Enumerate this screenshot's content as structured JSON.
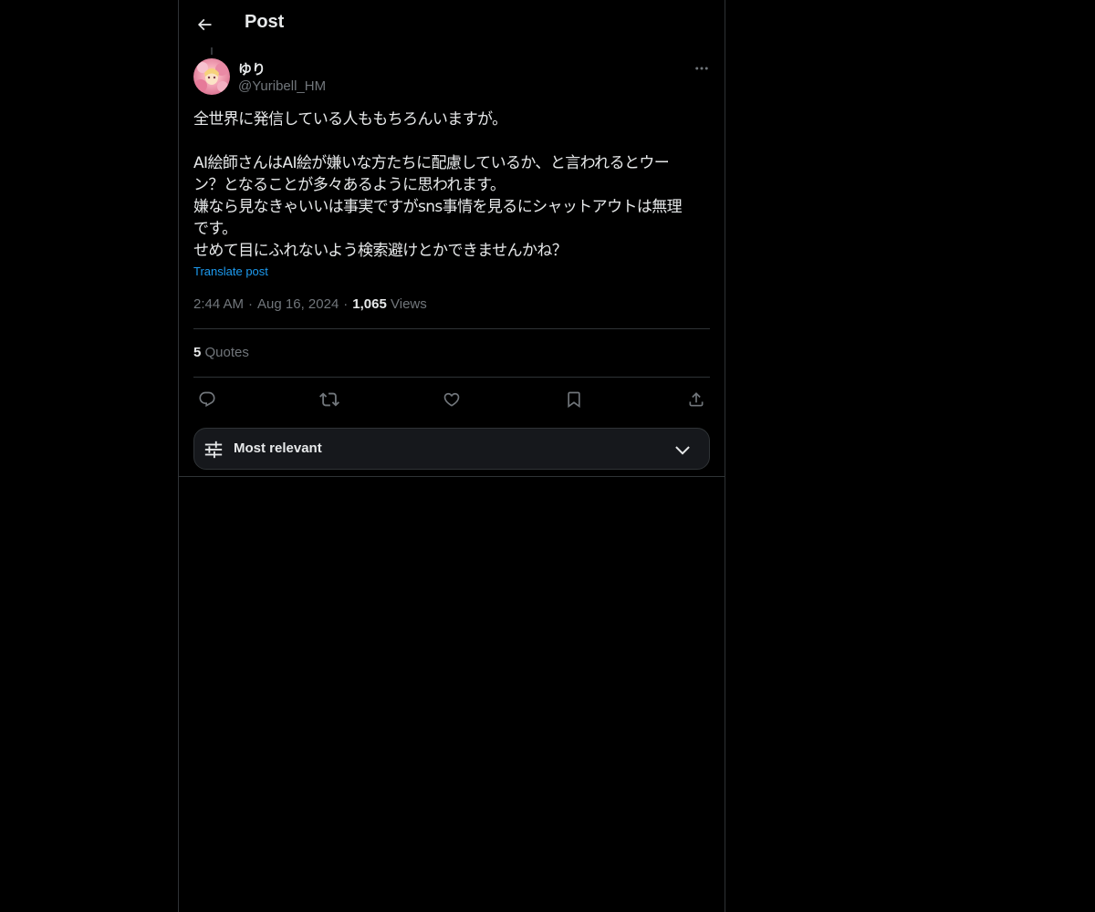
{
  "header": {
    "title": "Post"
  },
  "post": {
    "display_name": "ゆり",
    "handle": "@Yuribell_HM",
    "body": "全世界に発信している人ももちろんいますが。\n\nAI絵師さんはAI絵が嫌いな方たちに配慮しているか、と言われるとウー\nン？となることが多々あるように思われます。\n嫌なら見なきゃいいは事実ですがsns事情を見るにシャットアウトは無理\nです。\nせめて目にふれないよう検索避けとかできませんかね？",
    "translate_label": "Translate post",
    "time": "2:44 AM",
    "date": "Aug 16, 2024",
    "views_count": "1,065",
    "views_label": "Views",
    "quotes_count": "5",
    "quotes_label": "Quotes"
  },
  "actions": {
    "reply": "reply-icon",
    "repost": "repost-icon",
    "like": "heart-icon",
    "bookmark": "bookmark-icon",
    "share": "share-icon"
  },
  "sort": {
    "label": "Most relevant"
  },
  "colors": {
    "background": "#000000",
    "text": "#e7e9ea",
    "muted": "#71767b",
    "link": "#1d9bf0",
    "border": "#2f3336"
  }
}
